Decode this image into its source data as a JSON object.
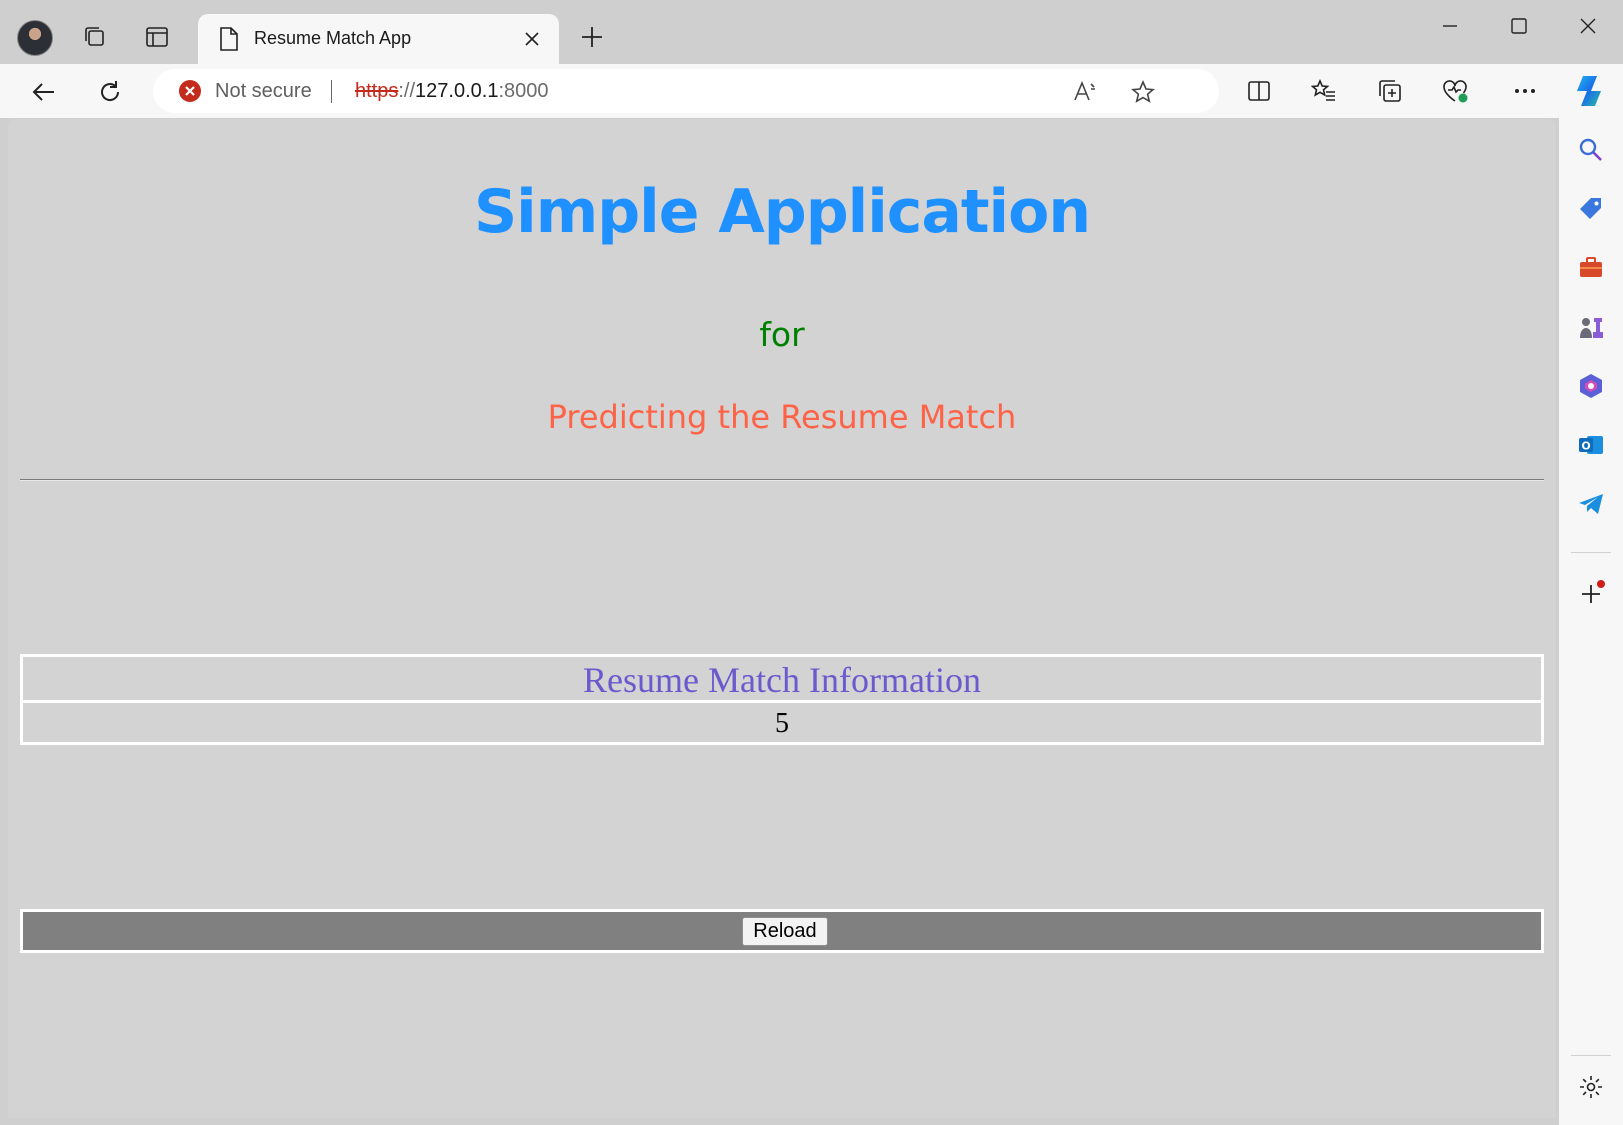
{
  "browser": {
    "tab": {
      "title": "Resume Match App"
    },
    "address_bar": {
      "security_label": "Not secure",
      "url_scheme": "https",
      "url_sep": "://",
      "url_host": "127.0.0.1",
      "url_port": ":8000"
    }
  },
  "page": {
    "title": "Simple Application",
    "for_text": "for",
    "subtitle": "Predicting the Resume Match",
    "info_table": {
      "header": "Resume Match Information",
      "value": "5"
    },
    "reload_label": "Reload"
  },
  "colors": {
    "title": "#1e90ff",
    "for_text": "#008000",
    "subtitle": "#ff6347",
    "table_header": "#6a5acd",
    "reload_bar": "#808080"
  }
}
